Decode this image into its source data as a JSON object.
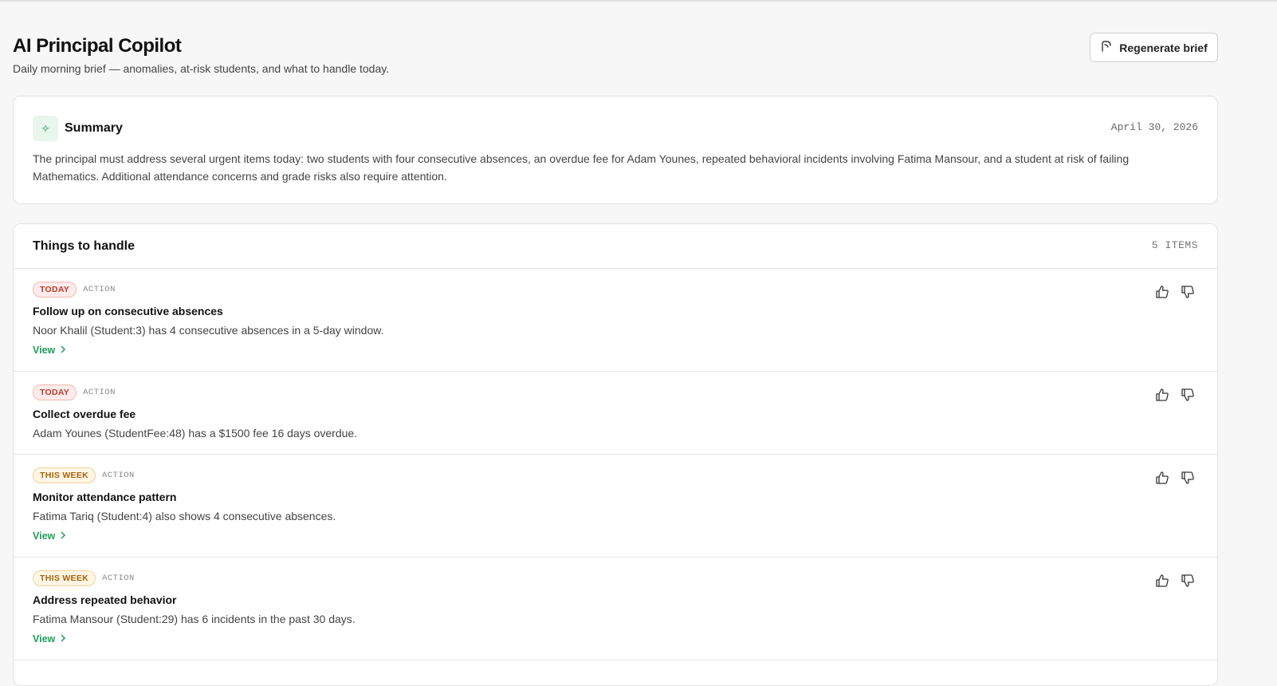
{
  "header": {
    "title": "AI Principal Copilot",
    "subtitle": "Daily morning brief — anomalies, at-risk students, and what to handle today.",
    "regenerate_label": "Regenerate brief"
  },
  "summary": {
    "title": "Summary",
    "date": "April 30, 2026",
    "text": "The principal must address several urgent items today: two students with four consecutive absences, an overdue fee for Adam Younes, repeated behavioral incidents involving Fatima Mansour, and a student at risk of failing Mathematics. Additional attendance concerns and grade risks also require attention."
  },
  "handle": {
    "title": "Things to handle",
    "count": "5 ITEMS",
    "items": [
      {
        "badge": "TODAY",
        "kind": "ACTION",
        "title": "Follow up on consecutive absences",
        "desc": "Noor Khalil (Student:3) has 4 consecutive absences in a 5-day window.",
        "link": "View"
      },
      {
        "badge": "TODAY",
        "kind": "ACTION",
        "title": "Collect overdue fee",
        "desc": "Adam Younes (StudentFee:48) has a $1500 fee 16 days overdue."
      },
      {
        "badge": "THIS WEEK",
        "kind": "ACTION",
        "title": "Monitor attendance pattern",
        "desc": "Fatima Tariq (Student:4) also shows 4 consecutive absences.",
        "link": "View"
      },
      {
        "badge": "THIS WEEK",
        "kind": "ACTION",
        "title": "Address repeated behavior",
        "desc": "Fatima Mansour (Student:29) has 6 incidents in the past 30 days.",
        "link": "View"
      }
    ]
  },
  "icons": {
    "regenerate": "regenerate-icon",
    "summary": "sparkle-icon",
    "like": "thumbs-up-icon",
    "dislike": "thumbs-down-icon",
    "link": "chevron-right-icon"
  },
  "colors": {
    "accent_green": "#1e9e5a",
    "today_red": "#c0392b",
    "week_amber": "#a8620a"
  }
}
